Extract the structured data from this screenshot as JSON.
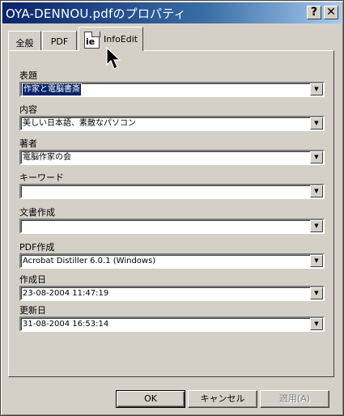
{
  "window": {
    "title": "OYA-DENNOU.pdfのプロパティ",
    "help_label": "?",
    "close_label": "✕"
  },
  "tabs": [
    {
      "label": "全般"
    },
    {
      "label": "PDF"
    },
    {
      "label": "InfoEdit",
      "icon": "ie-icon",
      "icon_text": "ie"
    }
  ],
  "fields": {
    "title": {
      "label": "表題",
      "value": "作家と電脳書斎"
    },
    "content": {
      "label": "内容",
      "value": "美しい日本語、素敵なパソコン"
    },
    "author": {
      "label": "著者",
      "value": "電脳作家の会"
    },
    "keywords": {
      "label": "キーワード",
      "value": ""
    },
    "doc_creator": {
      "label": "文書作成",
      "value": ""
    },
    "pdf_producer": {
      "label": "PDF作成",
      "value": "Acrobat Distiller 6.0.1 (Windows)"
    },
    "created": {
      "label": "作成日",
      "value": "23-08-2004 11:47:19"
    },
    "modified": {
      "label": "更新日",
      "value": "31-08-2004 16:53:14"
    }
  },
  "dropdown_glyph": "▼",
  "buttons": {
    "ok": "OK",
    "cancel": "キャンセル",
    "apply": "適用(A)"
  },
  "colors": {
    "titlebar_start": "#0a246a",
    "titlebar_end": "#a6caf0",
    "face": "#d4d0c8",
    "selection": "#0a246a"
  }
}
